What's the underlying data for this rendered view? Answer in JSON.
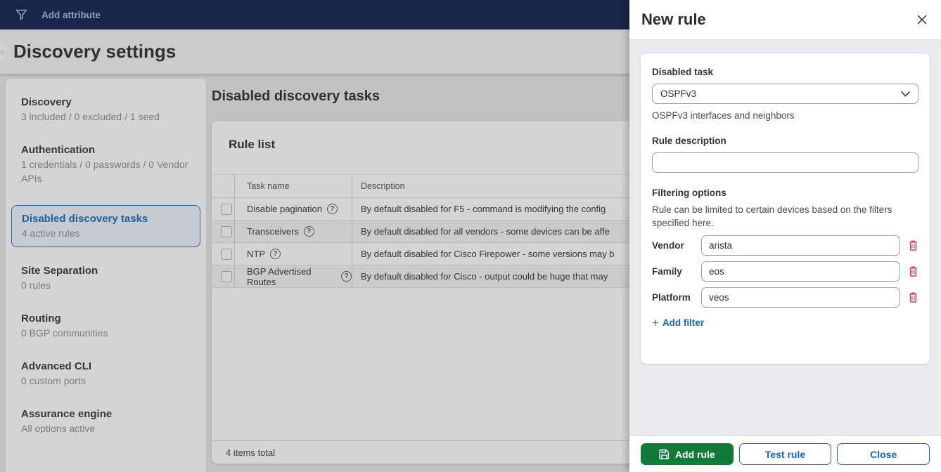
{
  "colors": {
    "topbar_navy": "#1b2b5a",
    "accent_blue": "#1766c2",
    "selected_blue": "#2373bd",
    "success_green": "#117a38",
    "danger_red": "#c9444f"
  },
  "topbar": {
    "add_attribute_label": "Add attribute"
  },
  "page": {
    "title": "Discovery settings"
  },
  "sidebar": {
    "items": [
      {
        "label": "Discovery",
        "sublabel": "3 included / 0 excluded / 1 seed",
        "selected": false
      },
      {
        "label": "Authentication",
        "sublabel": "1 credentials / 0 passwords / 0 Vendor APIs",
        "selected": false
      },
      {
        "label": "Disabled discovery tasks",
        "sublabel": "4 active rules",
        "selected": true
      },
      {
        "label": "Site Separation",
        "sublabel": "0 rules",
        "selected": false
      },
      {
        "label": "Routing",
        "sublabel": "0 BGP communities",
        "selected": false
      },
      {
        "label": "Advanced CLI",
        "sublabel": "0 custom ports",
        "selected": false
      },
      {
        "label": "Assurance engine",
        "sublabel": "All options active",
        "selected": false
      }
    ]
  },
  "main": {
    "section_title": "Disabled discovery tasks",
    "card_title": "Rule list",
    "table": {
      "columns": {
        "task": "Task name",
        "description": "Description"
      },
      "rows": [
        {
          "task": "Disable pagination",
          "description": "By default disabled for F5 - command is modifying the config"
        },
        {
          "task": "Transceivers",
          "description": "By default disabled for all vendors - some devices can be affe"
        },
        {
          "task": "NTP",
          "description": "By default disabled for Cisco Firepower - some versions may b"
        },
        {
          "task": "BGP Advertised Routes",
          "description": "By default disabled for Cisco - output could be huge that may"
        }
      ]
    },
    "footer_total": "4 items total"
  },
  "drawer": {
    "title": "New rule",
    "disabled_task": {
      "label": "Disabled task",
      "value": "OSPFv3",
      "helper": "OSPFv3 interfaces and neighbors"
    },
    "rule_description": {
      "label": "Rule description",
      "value": ""
    },
    "filtering": {
      "title": "Filtering options",
      "description": "Rule can be limited to certain devices based on the filters specified here.",
      "filters": [
        {
          "label": "Vendor",
          "value": "arista"
        },
        {
          "label": "Family",
          "value": "eos"
        },
        {
          "label": "Platform",
          "value": "veos"
        }
      ],
      "add_filter_label": "Add filter"
    },
    "footer": {
      "add_rule_label": "Add rule",
      "test_rule_label": "Test rule",
      "close_label": "Close"
    }
  }
}
